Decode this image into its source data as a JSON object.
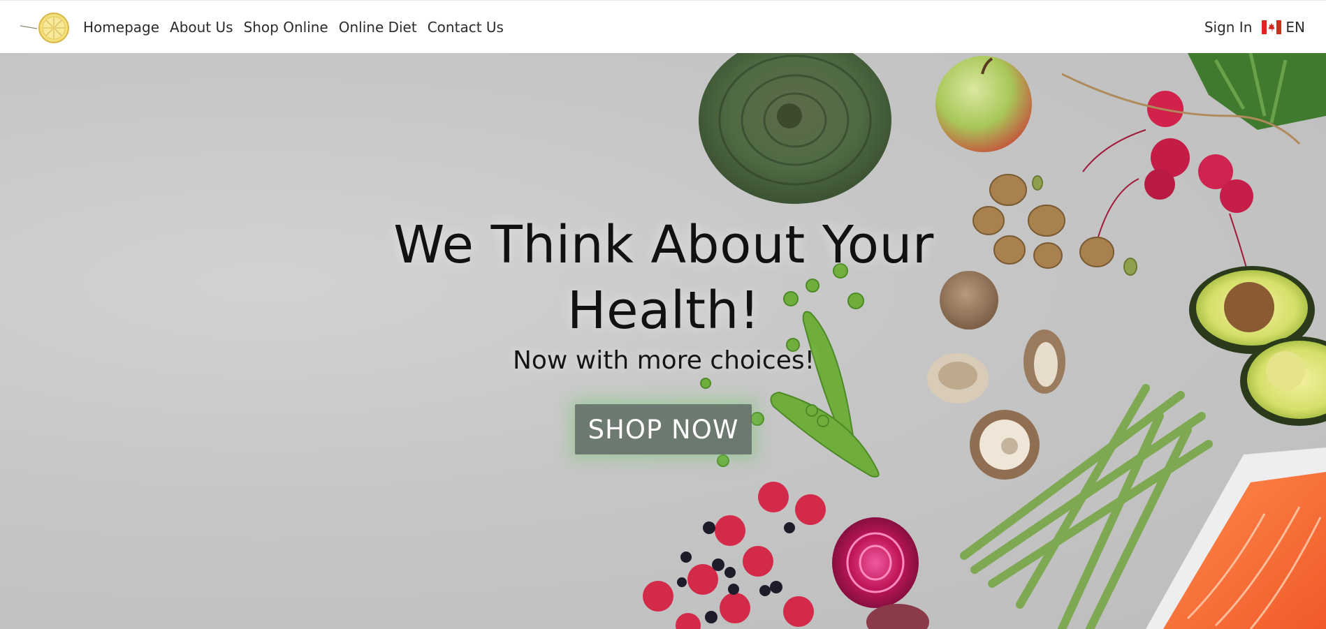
{
  "nav": {
    "logo_alt": "lemon-logo",
    "links": [
      {
        "label": "Homepage"
      },
      {
        "label": "About Us"
      },
      {
        "label": "Shop Online"
      },
      {
        "label": "Online Diet"
      },
      {
        "label": "Contact Us"
      }
    ],
    "sign_in": "Sign In",
    "language": {
      "code": "EN",
      "flag": "canada-flag-icon"
    }
  },
  "hero": {
    "headline_line1": "We Think About Your",
    "headline_line2": "Health!",
    "subheadline": "Now with more choices!",
    "cta_label": "SHOP NOW"
  },
  "colors": {
    "nav_bg": "#ffffff",
    "hero_bg": "#c6c6c6",
    "cta_bg": "#5f6e64",
    "cta_glow": "#78c86e"
  }
}
